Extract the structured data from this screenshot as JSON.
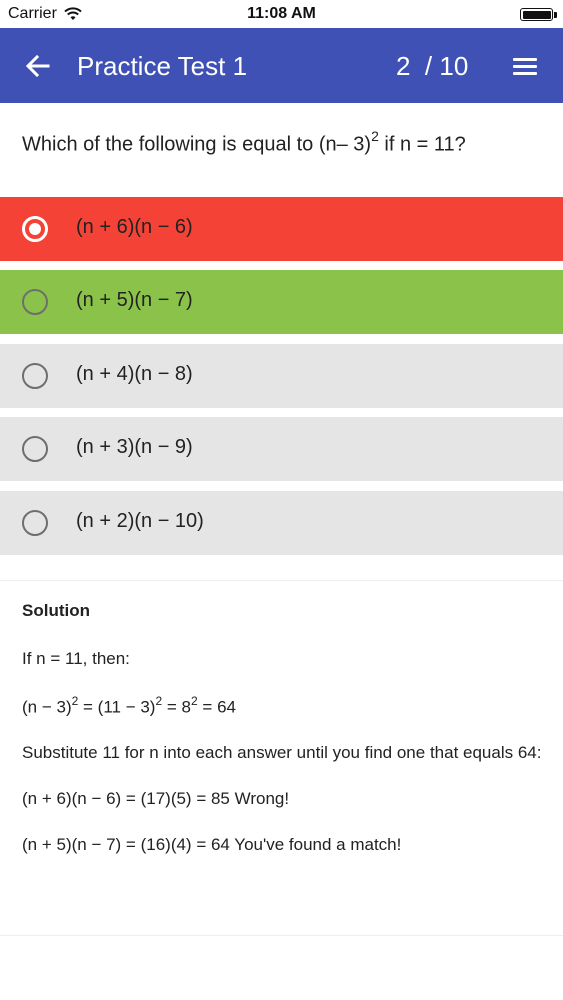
{
  "status_bar": {
    "carrier": "Carrier",
    "time": "11:08 AM",
    "wifi_icon": "wifi-icon",
    "battery_icon": "battery-icon"
  },
  "app_bar": {
    "title": "Practice Test 1",
    "progress": "2  / 10",
    "back_icon": "arrow-left-icon",
    "menu_icon": "hamburger-menu-icon",
    "color": "#3f51b5"
  },
  "question": {
    "prefix": "Which of the following is equal to (n– 3)",
    "exponent": "2",
    "suffix": " if n = 11?"
  },
  "options": [
    {
      "label": "(n + 6)(n − 6)",
      "state": "selected-wrong",
      "color": "#f44336"
    },
    {
      "label": "(n + 5)(n − 7)",
      "state": "correct",
      "color": "#8bc34a"
    },
    {
      "label": "(n + 4)(n − 8)",
      "state": "neutral",
      "color": "#e5e5e5"
    },
    {
      "label": "(n + 3)(n − 9)",
      "state": "neutral",
      "color": "#e5e5e5"
    },
    {
      "label": "(n + 2)(n − 10)",
      "state": "neutral",
      "color": "#e5e5e5"
    }
  ],
  "solution": {
    "heading": "Solution",
    "line1": "If n = 11, then:",
    "eq_part1": "(n − 3)",
    "eq_exp1": "2",
    "eq_part2": " = (11 − 3)",
    "eq_exp2": "2",
    "eq_part3": " = 8",
    "eq_exp3": "2",
    "eq_part4": " = 64",
    "line3": "Substitute 11 for n into each answer until you find one that equals 64:",
    "line4": "(n + 6)(n − 6) = (17)(5) = 85 Wrong!",
    "line5": "(n + 5)(n − 7) = (16)(4) = 64 You've found a match!"
  }
}
